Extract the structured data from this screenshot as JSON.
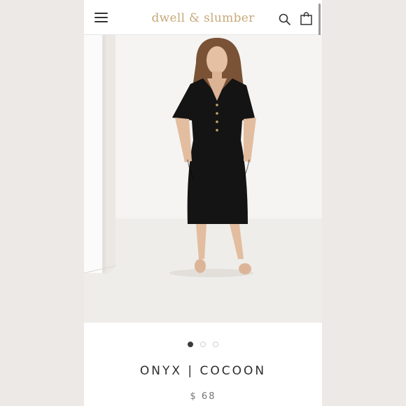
{
  "header": {
    "brand": "dwell & slumber",
    "menu_icon": "hamburger-menu-icon",
    "search_icon": "search-icon",
    "cart_icon": "shopping-bag-icon"
  },
  "product": {
    "image_alt": "Model wearing a black short-sleeve midi dress with gold buttons and side pockets",
    "title": "ONYX | COCOON",
    "price": "$ 68",
    "carousel": {
      "count": 3,
      "active": 1
    }
  },
  "colors": {
    "brand": "#c6a97a",
    "background": "#ece9e7",
    "dress": "#141414"
  }
}
